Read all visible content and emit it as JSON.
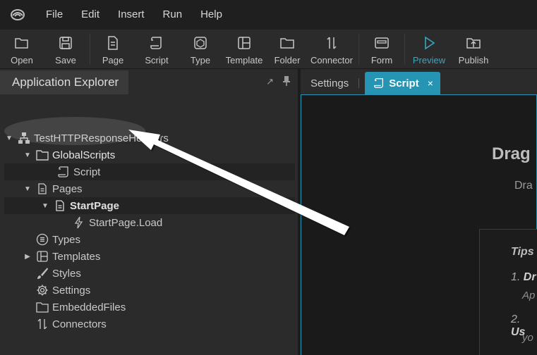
{
  "menubar": {
    "logo_icon": "app-logo-icon",
    "items": [
      "File",
      "Edit",
      "Insert",
      "Run",
      "Help"
    ]
  },
  "toolbar": {
    "buttons": [
      {
        "label": "Open",
        "icon": "folder-open-icon"
      },
      {
        "label": "Save",
        "icon": "floppy-icon"
      },
      {
        "label": "Page",
        "icon": "page-icon"
      },
      {
        "label": "Script",
        "icon": "scroll-icon"
      },
      {
        "label": "Type",
        "icon": "cube-icon"
      },
      {
        "label": "Template",
        "icon": "layout-icon"
      },
      {
        "label": "Folder",
        "icon": "folder-icon"
      },
      {
        "label": "Connector",
        "icon": "arrows-updown-icon"
      },
      {
        "label": "Form",
        "icon": "form-icon"
      },
      {
        "label": "Preview",
        "icon": "play-icon"
      },
      {
        "label": "Publish",
        "icon": "publish-icon"
      }
    ],
    "preview_color": "#3aa5c3"
  },
  "explorer": {
    "title": "Application Explorer",
    "tree": [
      {
        "label": "TestHTTPResponseHeaders",
        "icon": "sitemap-icon"
      },
      {
        "label": "GlobalScripts",
        "icon": "folder-icon"
      },
      {
        "label": "Script",
        "icon": "scroll-icon"
      },
      {
        "label": "Pages",
        "icon": "pages-icon"
      },
      {
        "label": "StartPage",
        "icon": "page-icon"
      },
      {
        "label": "StartPage.Load",
        "icon": "lightning-icon"
      },
      {
        "label": "Types",
        "icon": "list-circle-icon"
      },
      {
        "label": "Templates",
        "icon": "layout-icon"
      },
      {
        "label": "Styles",
        "icon": "brush-icon"
      },
      {
        "label": "Settings",
        "icon": "gear-icon"
      },
      {
        "label": "EmbeddedFiles",
        "icon": "folder-icon"
      },
      {
        "label": "Connectors",
        "icon": "arrows-updown-icon"
      }
    ]
  },
  "editor": {
    "tabs": [
      {
        "label": "Settings"
      },
      {
        "label": "Script",
        "icon": "scroll-icon",
        "close": "×"
      }
    ],
    "accent": "#2595b3",
    "heading": "Drag",
    "subheading": "Dra",
    "tips": {
      "title": "Tips",
      "tip1_num": "1.",
      "tip1_bold": "Dr",
      "tip1_sub": "Ap",
      "tip2_num": "2.",
      "tip2_bold": "Us",
      "tip2_sub": "yo"
    }
  }
}
